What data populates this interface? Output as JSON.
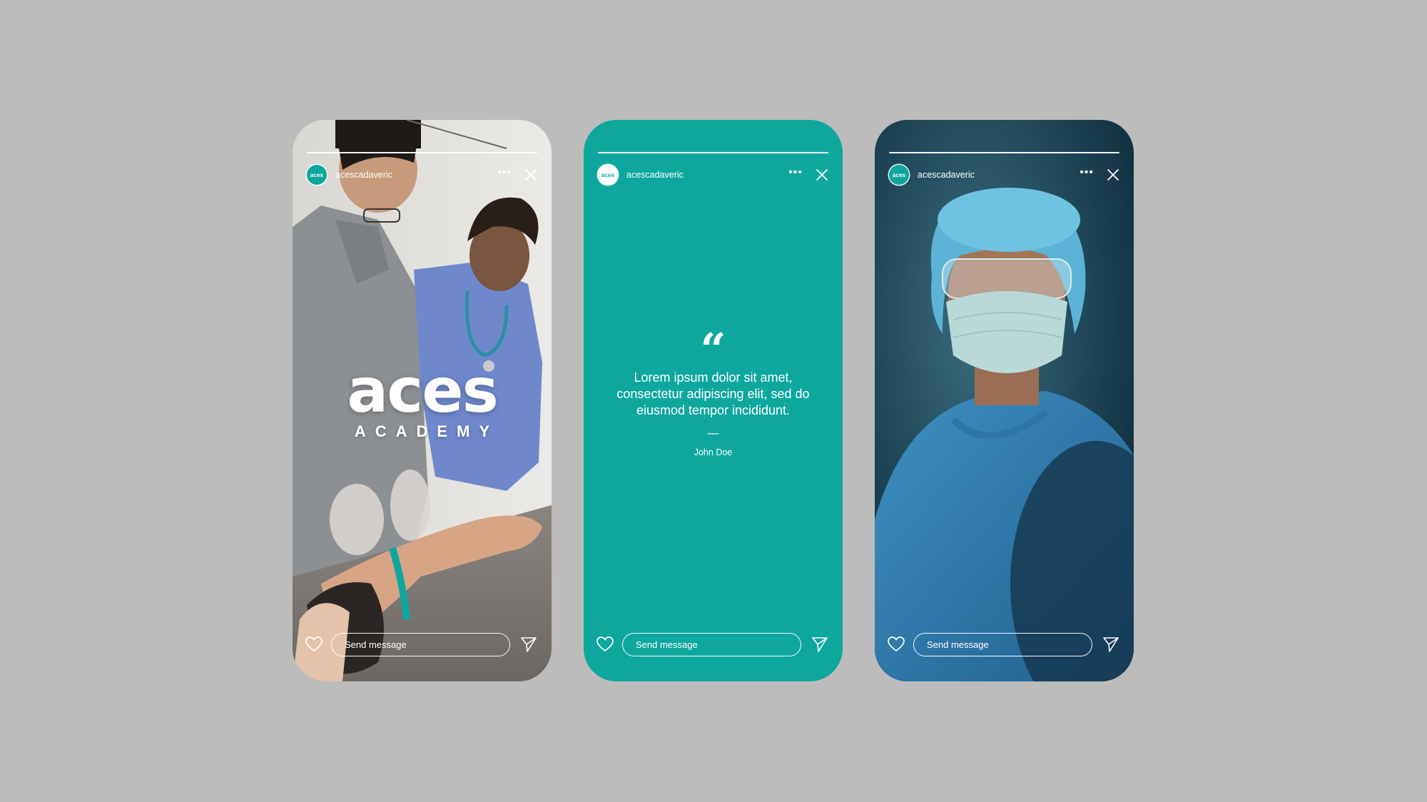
{
  "brand": {
    "avatar_text": "aces",
    "username": "acescadaveric",
    "logo_word": "aces",
    "logo_sub": "ACADEMY",
    "teal": "#0ea79e"
  },
  "stories": [
    {
      "username": "acescadaveric",
      "message_placeholder": "Send message",
      "logo_word": "aces",
      "logo_sub": "ACADEMY"
    },
    {
      "username": "acescadaveric",
      "message_placeholder": "Send message",
      "quote_mark": "“",
      "quote_text": "Lorem ipsum dolor sit amet, consectetur adipiscing elit, sed do eiusmod tempor incididunt.",
      "quote_dash": "—",
      "quote_author": "John Doe"
    },
    {
      "username": "acescadaveric",
      "message_placeholder": "Send message"
    }
  ],
  "icons": {
    "more": "more-horizontal-icon",
    "close": "close-icon",
    "heart": "heart-icon",
    "send": "send-icon"
  }
}
